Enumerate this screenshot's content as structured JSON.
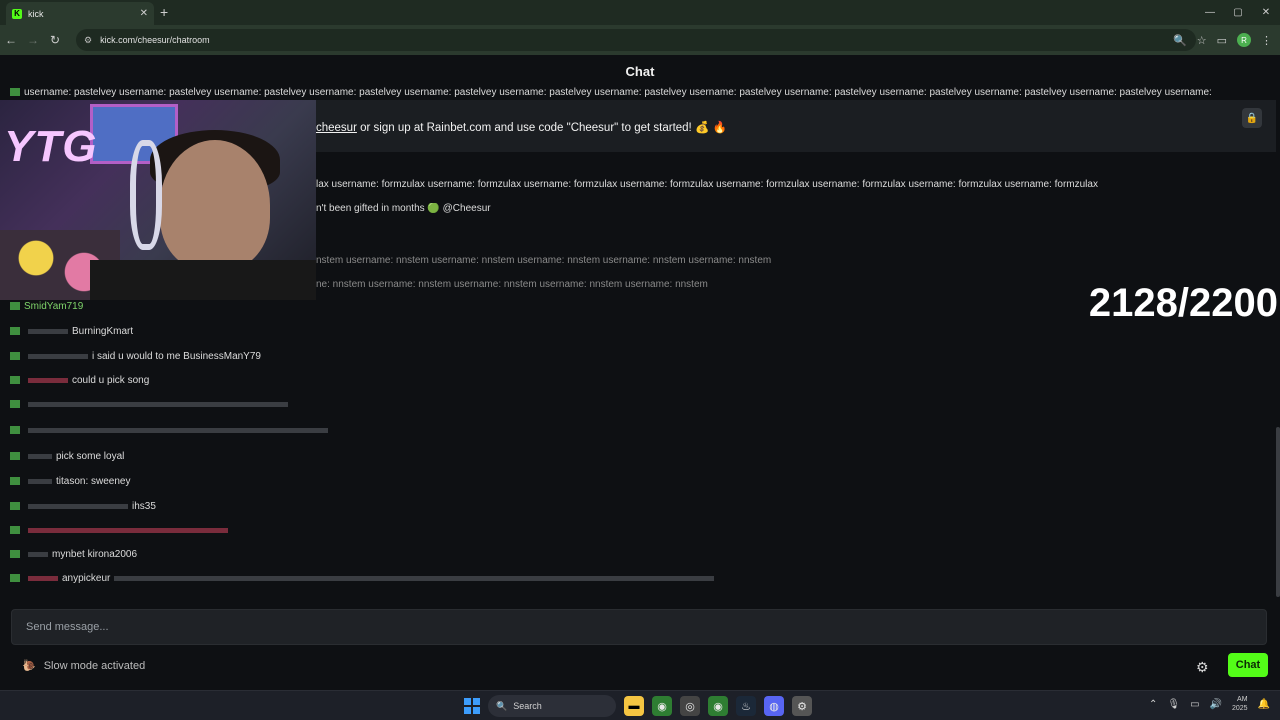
{
  "browser": {
    "tab_title": "kick",
    "tab_close": "✕",
    "new_tab": "+",
    "win_min": "—",
    "win_max": "▢",
    "win_close": "✕",
    "url": "kick.com/cheesur/chatroom"
  },
  "chat": {
    "header_title": "Chat",
    "pinned_link": "cheesur",
    "pinned_text": " or sign up at Rainbet.com and use code \"Cheesur\" to get started! 💰 🔥",
    "counter": "2128/2200",
    "messages": [
      "username: pastelvey username: pastelvey username: pastelvey username: pastelvey username: pastelvey username: pastelvey username: pastelvey username: pastelvey username: pastelvey username: pastelvey username: pastelvey username: pastelvey username:",
      "lax username: formzulax username: formzulax username: formzulax username: formzulax username: formzulax username: formzulax username: formzulax username: formzulax",
      "n't been gifted in months 🟢 @Cheesur",
      "nstem username: nnstem username: nnstem username: nnstem username: nnstem username: nnstem",
      "ne: nnstem username: nnstem username: nnstem username: nnstem username: nnstem",
      "SmidYam719",
      "BurningKmart",
      "i said u would to me BusinessManY79",
      "could u pick song",
      "pick some loyal",
      "titason: sweeney",
      "ihs35",
      "mynbet kirona2006",
      "anypickeur"
    ],
    "composer_placeholder": "Send message...",
    "slow_mode": "Slow mode activated",
    "send_button": "Chat"
  },
  "taskbar": {
    "search": "Search",
    "time": "AM",
    "date": "2025"
  }
}
